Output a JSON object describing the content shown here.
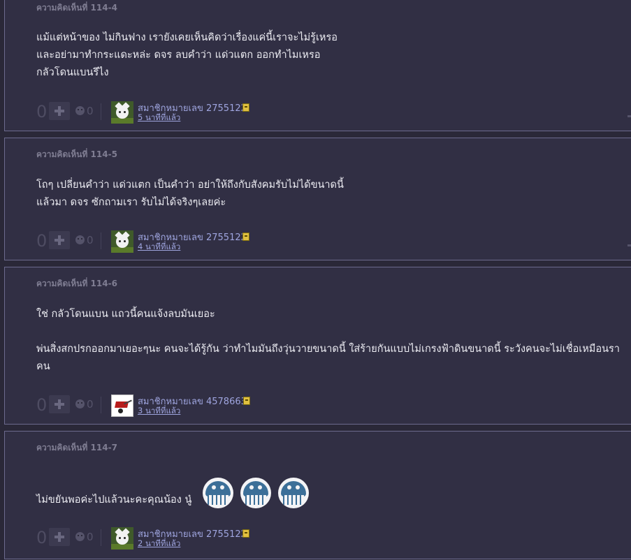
{
  "comments": [
    {
      "id_label": "ความคิดเห็นที่ 114-4",
      "lines": [
        "แม้แต่หน้าของ ไม่กินฟาง เรายังเคยเห็นคิดว่าเรื่องแค่นี้เราจะไม่รู้เหรอ",
        "และอย่ามาทำกระแดะหล่ะ ดจร ลบคำว่า แด่วแตก ออกทำไมเหรอ",
        "กลัวโดนแบนรึไง"
      ],
      "votes": "0",
      "emotions": "0",
      "avatar_icon": "cat-avatar-icon",
      "username": "สมาชิกหมายเลข 2755122",
      "time": "5 นาทีที่แล้ว"
    },
    {
      "id_label": "ความคิดเห็นที่ 114-5",
      "lines": [
        "โถๆ เปลี่ยนคำว่า แด่วแตก เป็นคำว่า อย่าให้ถึงกับสังคมรับไม่ได้ขนาดนี้",
        "แล้วมา ดจร ซักถามเรา รับไม่ได้จริงๆเลยค่ะ"
      ],
      "votes": "0",
      "emotions": "0",
      "avatar_icon": "cat-avatar-icon",
      "username": "สมาชิกหมายเลข 2755122",
      "time": "4 นาทีที่แล้ว"
    },
    {
      "id_label": "ความคิดเห็นที่ 114-6",
      "lines": [
        "ใช่ กลัวโดนแบน แถวนี้คนแจ้งลบมันเยอะ",
        "",
        "พ่นสิ่งสกปรกออกมาเยอะๆนะ คนจะได้รู้กัน ว่าทำไมมันถึงวุ่นวายขนาดนี้ ใส่ร้ายกันแบบไม่เกรงฟ้าดินขนาดนี้ ระวังคนจะไม่เชื่อเหมือนรา",
        "คน"
      ],
      "votes": "0",
      "emotions": "0",
      "avatar_icon": "wheelbarrow-avatar-icon",
      "username": "สมาชิกหมายเลข 4578663",
      "time": "3 นาทีที่แล้ว"
    },
    {
      "id_label": "ความคิดเห็นที่ 114-7",
      "lines": [
        "ไม่ขยันพอค่ะไปแล้วนะคะคุณน้อง นู๋"
      ],
      "stickers": [
        "octopus-sticker-icon",
        "octopus-sticker-icon",
        "octopus-sticker-icon"
      ],
      "votes": "0",
      "emotions": "0",
      "avatar_icon": "cat-avatar-icon",
      "username": "สมาชิกหมายเลข 2755122",
      "time": "2 นาทีที่แล้ว"
    }
  ]
}
